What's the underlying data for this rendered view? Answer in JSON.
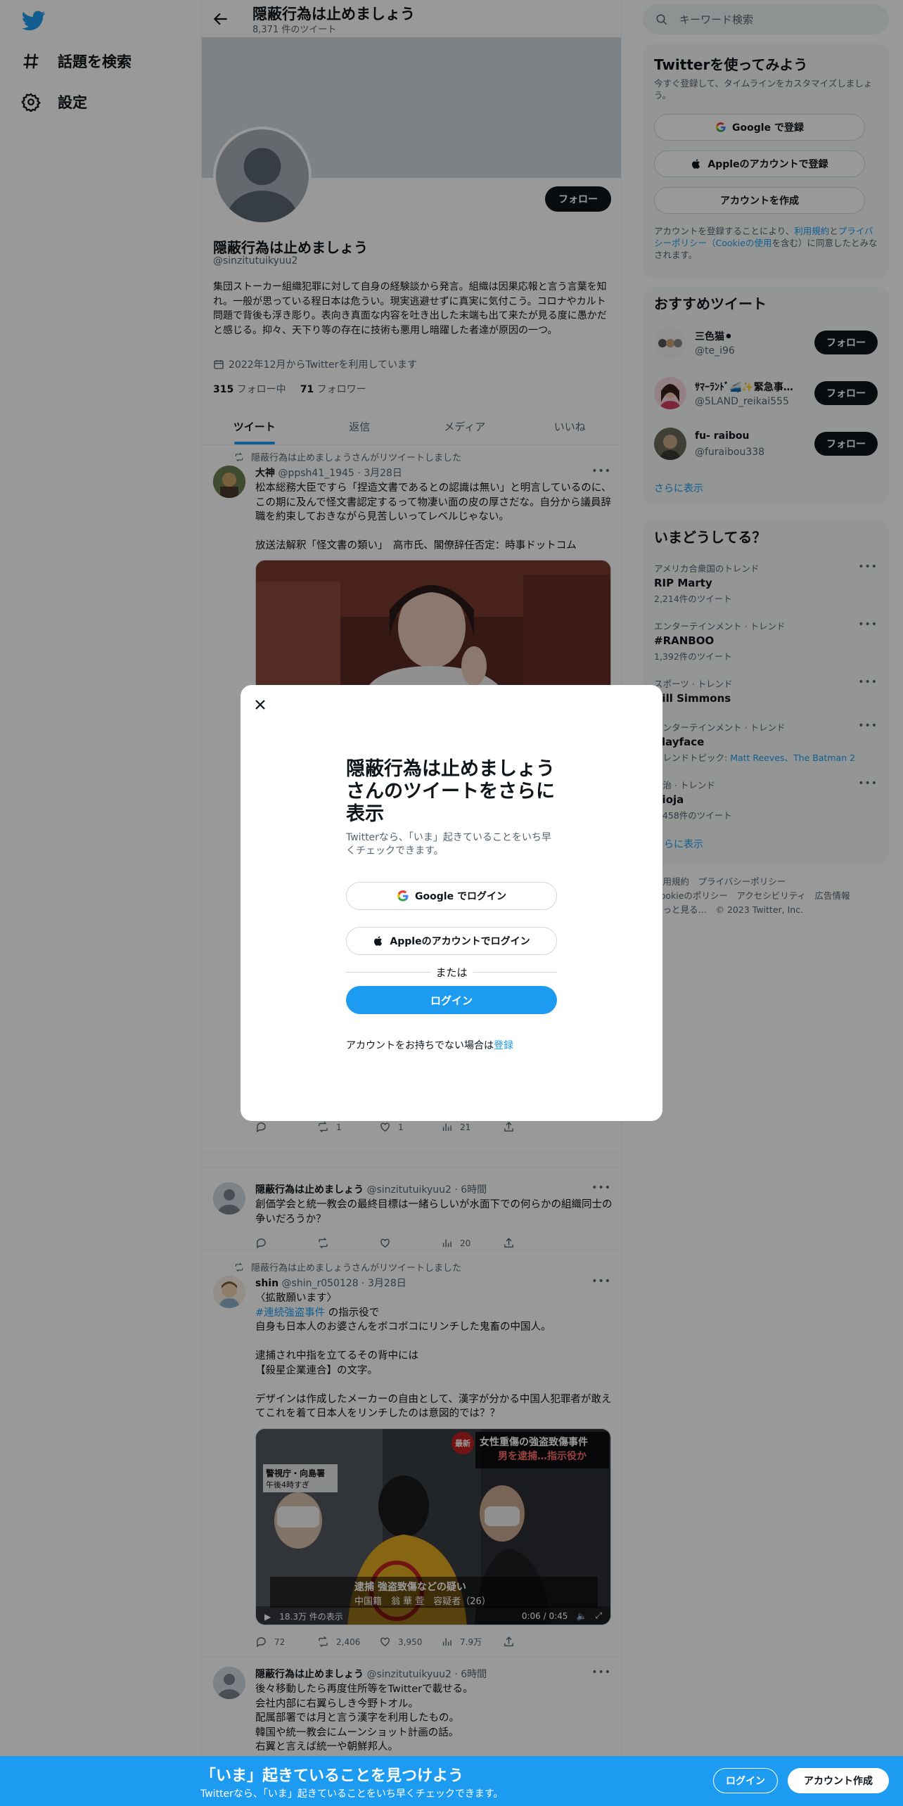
{
  "nav": {
    "explore": "話題を検索",
    "settings": "設定"
  },
  "profile": {
    "title": "隠蔽行為は止めましょう",
    "tweet_count": "8,371 件のツイート",
    "name": "隠蔽行為は止めましょう",
    "handle": "@sinzitutuikyuu2",
    "follow": "フォロー",
    "bio": "集団ストーカー組織犯罪に対して自身の経験談から発言。組織は因果応報と言う言葉を知れ。一般が思っている程日本は危うい。現実逃避せずに真実に気付こう。コロナやカルト問題で背後も浮き彫り。表向き真面な内容を吐き出した末端も出て来たが見る度に愚かだと感じる。抑々、天下り等の存在に技術も悪用し暗躍した者達が原因の一つ。",
    "joined": "2022年12月からTwitterを利用しています",
    "following_count": "315",
    "following_label": "フォロー中",
    "followers_count": "71",
    "followers_label": "フォロワー"
  },
  "tabs": [
    "ツイート",
    "返信",
    "メディア",
    "いいね"
  ],
  "tweets": [
    {
      "retweeted_by": "隠蔽行為は止めましょうさんがリツイートしました",
      "name": "大神",
      "meta": "@ppsh41_1945 · 3月28日",
      "text": "松本総務大臣ですら「捏造文書であるとの認識は無い」と明言しているのに、この期に及んで怪文書認定するって物凄い面の皮の厚さだな。自分から議員辞職を約束しておきながら見苦しいってレベルじゃない。\n\n放送法解釈「怪文書の類い」　高市氏、閣僚辞任否定：時事ドットコム"
    },
    {
      "replies": "",
      "retweets": "1",
      "likes": "1",
      "views": "21"
    },
    {
      "name": "隠蔽行為は止めましょう",
      "meta": "@sinzitutuikyuu2 · 6時間",
      "text": "創価学会と統一教会の最終目標は一緒らしいが水面下での何らかの組織同士の争いだろうか？",
      "views": "20"
    },
    {
      "retweeted_by": "隠蔽行為は止めましょうさんがリツイートしました",
      "name": "shin",
      "meta": "@shin_r050128 · 3月28日",
      "text_pre": "〈拡散願います〉",
      "hashtag": "#連続強盗事件",
      "text_tag_suffix": " の指示役で",
      "text_post": "自身も日本人のお婆さんをボコボコにリンチした鬼畜の中国人。\n\n逮捕され中指を立てるその背中には\n【殺星企業連合】の文字。\n\nデザインは作成したメーカーの自由として、漢字が分かる中国人犯罪者が敢えてこれを着て日本人をリンチしたのは意図的では？？",
      "video_badge": "最新",
      "video_headline1": "女性重傷の強盗致傷事件",
      "video_headline2": "男を逮捕…指示役か",
      "video_place": "警視庁・向島署",
      "video_time": "午後4時すぎ",
      "video_caption": "逮捕 強盗致傷などの疑い",
      "video_name": "中国籍　翁 華 萱　容疑者（26）",
      "video_views": "18.3万 件の表示",
      "video_duration": "0:06 / 0:45",
      "replies": "72",
      "retweets": "2,406",
      "likes": "3,950",
      "views": "7.9万"
    },
    {
      "name": "隠蔽行為は止めましょう",
      "meta": "@sinzitutuikyuu2 · 6時間",
      "text": "後々移動したら再度住所等をTwitterで載せる。\n会社内部に右翼らしき今野トオル。\n配属部署では月と言う漢字を利用したもの。\n韓国や統一教会にムーンショット計画の話。\n右翼と言えば統一や朝鮮邦人。"
    }
  ],
  "search_placeholder": "キーワード検索",
  "signup_card": {
    "title": "Twitterを使ってみよう",
    "subtitle": "今すぐ登録して、タイムラインをカスタマイズしましょう。",
    "google": "Google で登録",
    "apple": "Appleのアカウントで登録",
    "create": "アカウントを作成",
    "legal_pre": "アカウントを登録することにより、",
    "legal_terms": "利用規約",
    "legal_and": "と",
    "legal_privacy": "プライバシーポリシー",
    "legal_cookie": "（Cookieの使用",
    "legal_post": "を含む）に同意したとみなされます。"
  },
  "recommend": {
    "title": "おすすめツイート",
    "users": [
      {
        "name": "三色猫⚫",
        "handle": "@te_i96"
      },
      {
        "name": "ｻﾏｰﾗﾝﾄﾞ🚄✨緊急事…",
        "handle": "@5LAND_reikai555"
      },
      {
        "name": "fu- raibou",
        "handle": "@furaibou338"
      }
    ],
    "follow": "フォロー",
    "more": "さらに表示"
  },
  "trends": {
    "title": "いまどうしてる？",
    "items": [
      {
        "context": "アメリカ合衆国のトレンド",
        "name": "RIP Marty",
        "count": "2,214件のツイート"
      },
      {
        "context": "エンターテインメント · トレンド",
        "name": "#RANBOO",
        "count": "1,392件のツイート"
      },
      {
        "context": "スポーツ · トレンド",
        "name": "Bill Simmons",
        "count": ""
      },
      {
        "context": "エンターテインメント · トレンド",
        "name": "Clayface",
        "count_pre": "トレンドトピック: ",
        "topics": "Matt Reeves、The Batman 2"
      },
      {
        "context": "政治 · トレンド",
        "name": "Rioja",
        "count": "1,458件のツイート"
      }
    ],
    "more": "さらに表示"
  },
  "footer": "利用規約　プライバシーポリシー\nCookieのポリシー　アクセシビリティ　広告情報\nもっと見る…　© 2023 Twitter, Inc.",
  "modal": {
    "title": "隠蔽行為は止めましょうさんのツイートをさらに表示",
    "subtitle": "Twitterなら、「いま」起きていることをいち早くチェックできます。",
    "google": "Google でログイン",
    "apple": "Appleのアカウントでログイン",
    "or": "または",
    "login": "ログイン",
    "no_account": "アカウントをお持ちでない場合は",
    "signup": "登録"
  },
  "bottom_bar": {
    "headline": "「いま」起きていることを見つけよう",
    "sub": "Twitterなら、「いま」起きていることをいち早くチェックできます。",
    "login": "ログイン",
    "signup": "アカウント作成"
  },
  "colors": {
    "accent": "#1d9bf0",
    "dark": "#0f1419",
    "muted": "#536471"
  }
}
